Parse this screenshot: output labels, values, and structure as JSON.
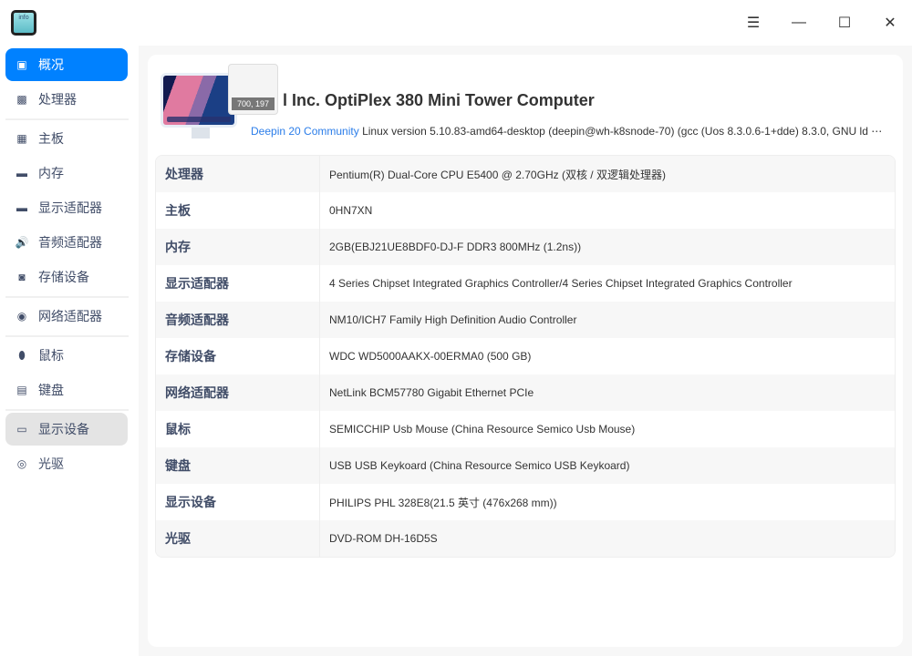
{
  "app": {
    "icon_text": "info"
  },
  "window": {
    "menu": "☰",
    "minimize": "—",
    "maximize": "☐",
    "close": "✕"
  },
  "sidebar": {
    "items": [
      {
        "label": "概况",
        "icon": "computer-icon",
        "glyph": "▣"
      },
      {
        "label": "处理器",
        "icon": "cpu-icon",
        "glyph": "▩"
      },
      {
        "label": "主板",
        "icon": "motherboard-icon",
        "glyph": "▦"
      },
      {
        "label": "内存",
        "icon": "memory-icon",
        "glyph": "▬"
      },
      {
        "label": "显示适配器",
        "icon": "gpu-icon",
        "glyph": "▬"
      },
      {
        "label": "音频适配器",
        "icon": "speaker-icon",
        "glyph": "🔊"
      },
      {
        "label": "存储设备",
        "icon": "disk-icon",
        "glyph": "◙"
      },
      {
        "label": "网络适配器",
        "icon": "network-icon",
        "glyph": "◉"
      },
      {
        "label": "鼠标",
        "icon": "mouse-icon",
        "glyph": "⬮"
      },
      {
        "label": "键盘",
        "icon": "keyboard-icon",
        "glyph": "▤"
      },
      {
        "label": "显示设备",
        "icon": "monitor-icon",
        "glyph": "▭"
      },
      {
        "label": "光驱",
        "icon": "disc-icon",
        "glyph": "◎"
      }
    ]
  },
  "overview": {
    "tooltip": "700, 197",
    "title": "l Inc. OptiPlex 380 Mini Tower Computer",
    "os_link": "Deepin 20 Community",
    "kernel": " Linux version 5.10.83-amd64-desktop (deepin@wh-k8snode-70) (gcc (Uos 8.3.0.6-1+dde) 8.3.0, GNU ld ⋯",
    "rows": [
      {
        "label": "处理器",
        "value": "Pentium(R) Dual-Core  CPU     E5400  @ 2.70GHz (双核 / 双逻辑处理器)"
      },
      {
        "label": "主板",
        "value": "0HN7XN"
      },
      {
        "label": "内存",
        "value": "2GB(EBJ21UE8BDF0-DJ-F DDR3 800MHz (1.2ns))"
      },
      {
        "label": "显示适配器",
        "value": "4 Series Chipset Integrated Graphics Controller/4 Series Chipset Integrated Graphics Controller"
      },
      {
        "label": "音频适配器",
        "value": "NM10/ICH7 Family High Definition Audio Controller"
      },
      {
        "label": "存储设备",
        "value": "WDC WD5000AAKX-00ERMA0 (500 GB)"
      },
      {
        "label": "网络适配器",
        "value": "NetLink BCM57780 Gigabit Ethernet PCIe"
      },
      {
        "label": "鼠标",
        "value": "SEMICCHIP Usb Mouse (China Resource Semico Usb Mouse)"
      },
      {
        "label": "键盘",
        "value": "USB USB Keykoard (China Resource Semico USB Keykoard)"
      },
      {
        "label": "显示设备",
        "value": "PHILIPS PHL 328E8(21.5 英寸 (476x268 mm))"
      },
      {
        "label": "光驱",
        "value": "DVD-ROM DH-16D5S"
      }
    ]
  }
}
